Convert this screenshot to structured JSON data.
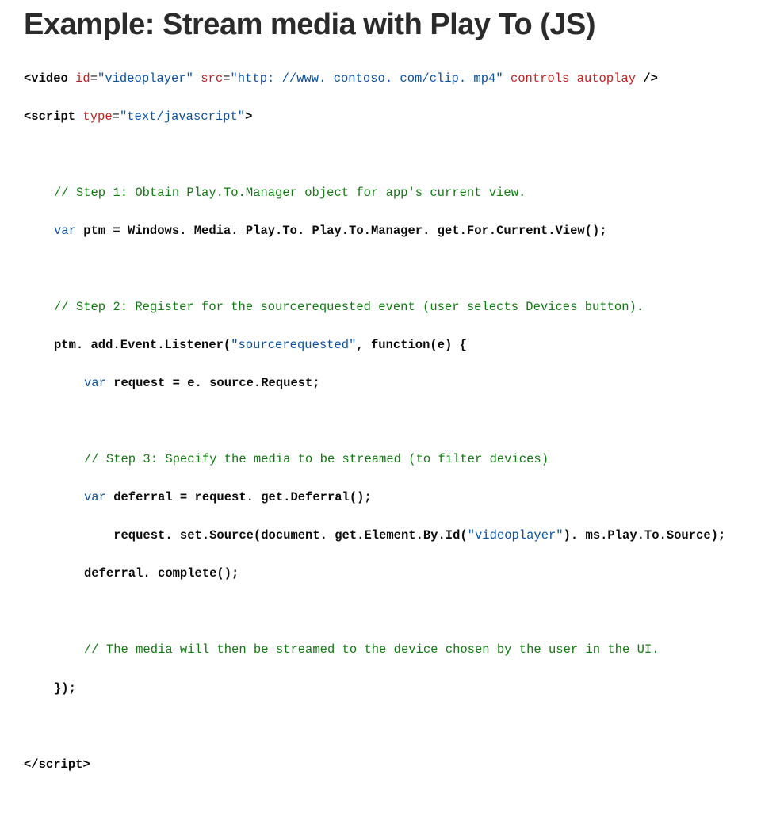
{
  "title": "Example: Stream media with Play To (JS)",
  "code": {
    "line1": {
      "tag_open": "<video",
      "attr_id": " id",
      "eq1": "=",
      "val_id": "\"videoplayer\"",
      "attr_src": " src",
      "eq2": "=",
      "val_src": "\"http: //www. contoso. com/clip. mp4\"",
      "attr_ctrl": " controls autoplay ",
      "tag_close": "/>"
    },
    "line2": {
      "tag_open": "<script",
      "attr_type": " type",
      "eq": "=",
      "val_type": "\"text/javascript\"",
      "gt": ">"
    },
    "blank1": " ",
    "c1": "// Step 1: Obtain Play.To.Manager object for app's current view.",
    "l4a": "var",
    "l4b": " ptm = Windows. Media. Play.To. Play.To.Manager. get.For.Current.View();",
    "blank2": " ",
    "c2": "// Step 2: Register for the sourcerequested event (user selects Devices button).",
    "l6a": "ptm. add.Event.Listener(",
    "l6b": "\"sourcerequested\"",
    "l6c": ", function(e) {",
    "l7a": "var",
    "l7b": " request = e. source.Request;",
    "blank3": " ",
    "c3": "// Step 3: Specify the media to be streamed (to filter devices)",
    "l9a": "var",
    "l9b": " deferral = request. get.Deferral();",
    "l10a": "    request. set.Source(document. get.Element.By.Id(",
    "l10b": "\"videoplayer\"",
    "l10c": "). ms.Play.To.Source);",
    "l11": "deferral. complete();",
    "blank4": " ",
    "c4": "// The media will then be streamed to the device chosen by the user in the UI.",
    "l13": "});",
    "blank5": " ",
    "l14": "</scr"
  },
  "script_close_tail": "ipt>"
}
